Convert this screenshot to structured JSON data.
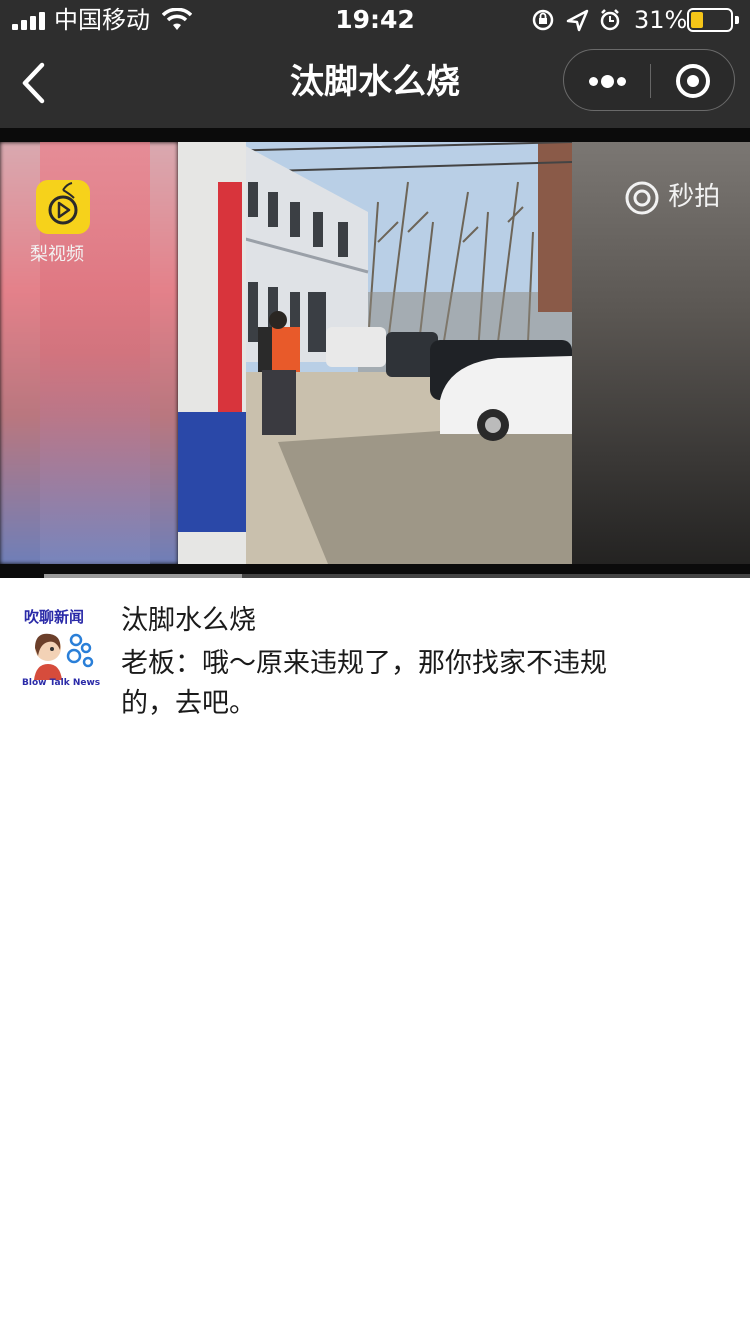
{
  "status_bar": {
    "carrier": "中国移动",
    "time": "19:42",
    "battery_percent": "31%",
    "battery_level": 0.31,
    "battery_color": "#f5c518"
  },
  "nav": {
    "title": "汰脚水么烧"
  },
  "video": {
    "watermark_left": "梨视频",
    "watermark_right": "秒拍",
    "progress": 0.28
  },
  "post": {
    "avatar_title": "吹聊新闻",
    "avatar_subtitle": "Blow Talk News",
    "title": "汰脚水么烧",
    "body": "老板：哦～原来违规了，那你找家不违规的，去吧。"
  }
}
